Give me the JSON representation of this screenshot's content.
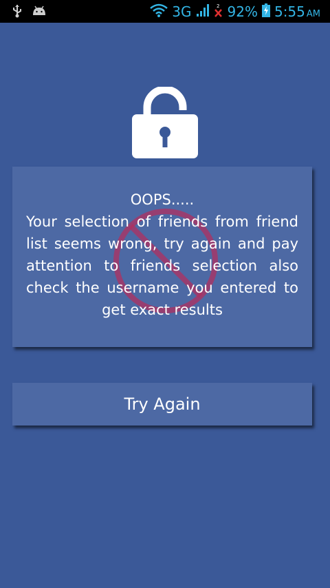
{
  "status_bar": {
    "network": "3G",
    "battery": "92%",
    "time": "5:55",
    "ampm": "AM",
    "icons": [
      "usb-icon",
      "android-icon",
      "wifi-icon",
      "signal-icon",
      "no-sim-icon",
      "battery-charging-icon"
    ]
  },
  "lock": {
    "icon": "unlocked-padlock-icon"
  },
  "message": {
    "title": "OOPS.....",
    "body": "Your selection of friends from friend list seems wrong, try again and pay attention to friends selection also check the username you entered to get exact results",
    "watermark_icon": "no-entry-icon"
  },
  "actions": {
    "try_again_label": "Try Again"
  },
  "colors": {
    "background": "#3b5998",
    "card": "#4d69a4",
    "status_bar": "#000000",
    "status_icon": "#33b5e5",
    "text": "#ffffff",
    "watermark": "#b03060"
  }
}
